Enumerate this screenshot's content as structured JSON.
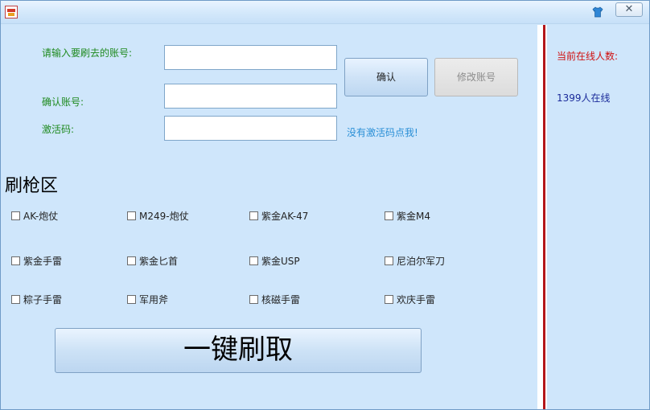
{
  "titlebar": {
    "close_label": "✕"
  },
  "form": {
    "account_label": "请输入要刷去的账号:",
    "account_value": "",
    "confirm_account_label": "确认账号:",
    "confirm_account_value": "",
    "activation_code_label": "激活码:",
    "activation_code_value": "",
    "confirm_button": "确认",
    "modify_button": "修改账号",
    "no_code_link": "没有激活码点我!"
  },
  "weapons": {
    "title": "刷枪区",
    "items": [
      {
        "label": "AK-炮仗",
        "checked": false
      },
      {
        "label": "M249-炮仗",
        "checked": false
      },
      {
        "label": "紫金AK-47",
        "checked": false
      },
      {
        "label": "紫金M4",
        "checked": false
      },
      {
        "label": "紫金手雷",
        "checked": false
      },
      {
        "label": "紫金匕首",
        "checked": false
      },
      {
        "label": "紫金USP",
        "checked": false
      },
      {
        "label": "尼泊尔军刀",
        "checked": false
      },
      {
        "label": "粽子手雷",
        "checked": false
      },
      {
        "label": "军用斧",
        "checked": false
      },
      {
        "label": "核磁手雷",
        "checked": false
      },
      {
        "label": "欢庆手雷",
        "checked": false
      }
    ],
    "action_button": "一键刷取"
  },
  "side_panel": {
    "online_label": "当前在线人数:",
    "online_value": "1399人在线"
  },
  "colors": {
    "background": "#cfe6fb",
    "label_green": "#1f8a1f",
    "link_blue": "#2a8fd6",
    "online_label_red": "#d01010",
    "online_value_blue": "#1a2a9a",
    "divider_red": "#b4161a"
  }
}
